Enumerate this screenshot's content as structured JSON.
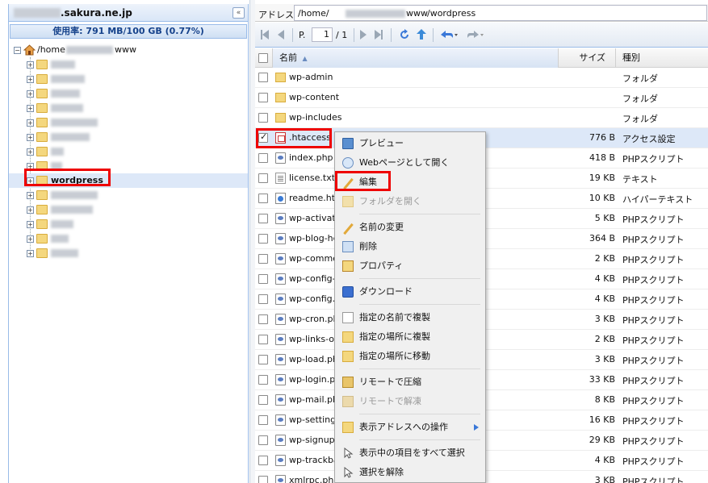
{
  "left_pane": {
    "host_suffix": ".sakura.ne.jp",
    "usage_text": "使用率: 791 MB/100 GB (0.77%)",
    "root": {
      "pre": "/home",
      "post": "www"
    },
    "selected_node": "wordpress"
  },
  "address_bar": {
    "label": "アドレス:",
    "prefix": "/home/",
    "mid": "www",
    "suffix": "/wordpress"
  },
  "toolbar": {
    "page_label": "P.",
    "page_value": "1",
    "page_total": "/ 1"
  },
  "grid": {
    "columns": {
      "name": "名前",
      "size": "サイズ",
      "type": "種別"
    },
    "rows": [
      {
        "name": "wp-admin",
        "size": "",
        "type": "フォルダ",
        "icon": "folder"
      },
      {
        "name": "wp-content",
        "size": "",
        "type": "フォルダ",
        "icon": "folder"
      },
      {
        "name": "wp-includes",
        "size": "",
        "type": "フォルダ",
        "icon": "folder"
      },
      {
        "name": ".htaccess",
        "size": "776 B",
        "type": "アクセス設定",
        "icon": "htaccess",
        "checked": true
      },
      {
        "name": "index.php",
        "size": "418 B",
        "type": "PHPスクリプト",
        "icon": "php"
      },
      {
        "name": "license.txt",
        "size": "19 KB",
        "type": "テキスト",
        "icon": "txt"
      },
      {
        "name": "readme.htm",
        "size": "10 KB",
        "type": "ハイパーテキスト",
        "icon": "htm"
      },
      {
        "name": "wp-activate",
        "size": "5 KB",
        "type": "PHPスクリプト",
        "icon": "php"
      },
      {
        "name": "wp-blog-hea",
        "size": "364 B",
        "type": "PHPスクリプト",
        "icon": "php"
      },
      {
        "name": "wp-commer",
        "size": "2 KB",
        "type": "PHPスクリプト",
        "icon": "php"
      },
      {
        "name": "wp-config-s",
        "size": "4 KB",
        "type": "PHPスクリプト",
        "icon": "php"
      },
      {
        "name": "wp-config.p",
        "size": "4 KB",
        "type": "PHPスクリプト",
        "icon": "php"
      },
      {
        "name": "wp-cron.php",
        "size": "3 KB",
        "type": "PHPスクリプト",
        "icon": "php"
      },
      {
        "name": "wp-links-op",
        "size": "2 KB",
        "type": "PHPスクリプト",
        "icon": "php"
      },
      {
        "name": "wp-load.php",
        "size": "3 KB",
        "type": "PHPスクリプト",
        "icon": "php"
      },
      {
        "name": "wp-login.ph",
        "size": "33 KB",
        "type": "PHPスクリプト",
        "icon": "php"
      },
      {
        "name": "wp-mail.php",
        "size": "8 KB",
        "type": "PHPスクリプト",
        "icon": "php"
      },
      {
        "name": "wp-settings",
        "size": "16 KB",
        "type": "PHPスクリプト",
        "icon": "php"
      },
      {
        "name": "wp-signup.p",
        "size": "29 KB",
        "type": "PHPスクリプト",
        "icon": "php"
      },
      {
        "name": "wp-trackbac",
        "size": "4 KB",
        "type": "PHPスクリプト",
        "icon": "php"
      },
      {
        "name": "xmlrpc.php",
        "size": "3 KB",
        "type": "PHPスクリプト",
        "icon": "php"
      }
    ]
  },
  "context_menu": {
    "items": {
      "preview": "プレビュー",
      "open_web": "Webページとして開く",
      "edit": "編集",
      "open_folder": "フォルダを開く",
      "rename": "名前の変更",
      "delete": "削除",
      "properties": "プロパティ",
      "download": "ダウンロード",
      "copy_name": "指定の名前で複製",
      "copy_place": "指定の場所に複製",
      "move_place": "指定の場所に移動",
      "compress": "リモートで圧縮",
      "extract": "リモートで解凍",
      "addr_ops": "表示アドレスへの操作",
      "select_all": "表示中の項目をすべて選択",
      "deselect": "選択を解除"
    }
  },
  "colors": {
    "highlight": "#e00000",
    "selection": "#dde8f8",
    "header_blue": "#15428b"
  }
}
